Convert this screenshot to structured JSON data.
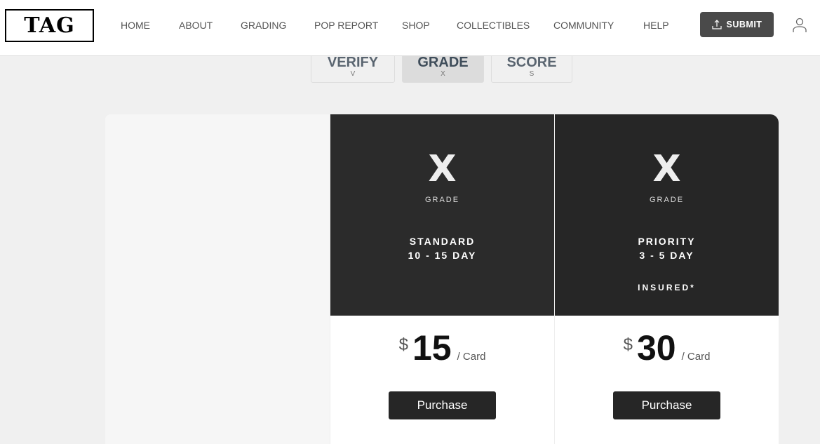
{
  "header": {
    "logo": "TAG",
    "nav": [
      "HOME",
      "ABOUT",
      "GRADING",
      "POP REPORT",
      "SHOP",
      "COLLECTIBLES",
      "COMMUNITY",
      "HELP"
    ],
    "submit_label": "SUBMIT"
  },
  "tabs": [
    {
      "label": "VERIFY",
      "sub": "V"
    },
    {
      "label": "GRADE",
      "sub": "X",
      "active": true
    },
    {
      "label": "SCORE",
      "sub": "S"
    }
  ],
  "plans": [
    {
      "grade": "X",
      "grade_label": "GRADE",
      "tier": "STANDARD",
      "turnaround": "10 - 15 DAY",
      "insured": "",
      "currency": "$",
      "price": "15",
      "unit": "/  Card",
      "button": "Purchase"
    },
    {
      "grade": "X",
      "grade_label": "GRADE",
      "tier": "PRIORITY",
      "turnaround": "3 - 5 DAY",
      "insured": "INSURED*",
      "currency": "$",
      "price": "30",
      "unit": "/  Card",
      "button": "Purchase"
    }
  ]
}
